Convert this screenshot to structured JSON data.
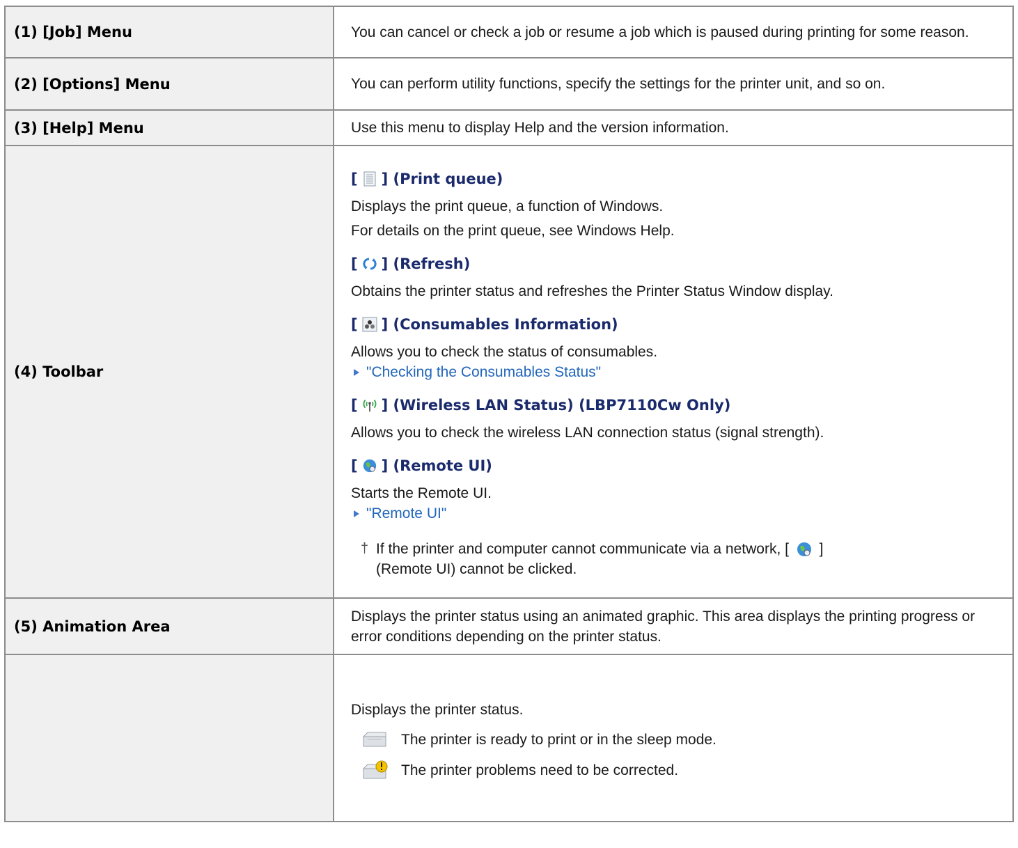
{
  "rows": [
    {
      "label": "(1) [Job] Menu",
      "text": "You can cancel or check a job or resume a job which is paused during printing for some reason."
    },
    {
      "label": "(2) [Options] Menu",
      "text": "You can perform utility functions, specify the settings for the printer unit, and so on."
    },
    {
      "label": "(3) [Help] Menu",
      "text": "Use this menu to display Help and the version information."
    },
    {
      "label": "(4) Toolbar"
    },
    {
      "label": "(5) Animation Area",
      "text": "Displays the printer status using an animated graphic. This area displays the printing progress or error conditions depending on the printer status."
    },
    {
      "label": ""
    }
  ],
  "toolbar": {
    "print_queue": {
      "heading_open": "[",
      "heading_close": "] (Print queue)",
      "icon": "print-queue-icon",
      "desc1": "Displays the print queue, a function of Windows.",
      "desc2": "For details on the print queue, see Windows Help."
    },
    "refresh": {
      "heading_open": "[",
      "heading_close": "] (Refresh)",
      "icon": "refresh-icon",
      "desc1": "Obtains the printer status and refreshes the Printer Status Window display."
    },
    "consumables": {
      "heading_open": "[",
      "heading_close": "] (Consumables Information)",
      "icon": "consumables-icon",
      "desc1": "Allows you to check the status of consumables.",
      "link": "\"Checking the Consumables Status\""
    },
    "wireless": {
      "heading_open": "[",
      "heading_close": "] (Wireless LAN Status) (LBP7110Cw Only)",
      "icon": "wireless-lan-icon",
      "desc1": "Allows you to check the wireless LAN connection status (signal strength)."
    },
    "remote_ui": {
      "heading_open": "[",
      "heading_close": "] (Remote UI)",
      "icon": "remote-ui-icon",
      "desc1": "Starts the Remote UI.",
      "link": "\"Remote UI\"",
      "note_a": "If the printer and computer cannot communicate via a network, [",
      "note_b": "]",
      "note_c": "(Remote UI) cannot be clicked."
    }
  },
  "status": {
    "intro": "Displays the printer status.",
    "ready": "The printer is ready to print or in the sleep mode.",
    "problem": "The printer problems need to be corrected."
  },
  "colors": {
    "heading": "#1a2a6c",
    "link": "#2266bb",
    "label_bg": "#f0f0f0",
    "border": "#8c8c8c"
  }
}
